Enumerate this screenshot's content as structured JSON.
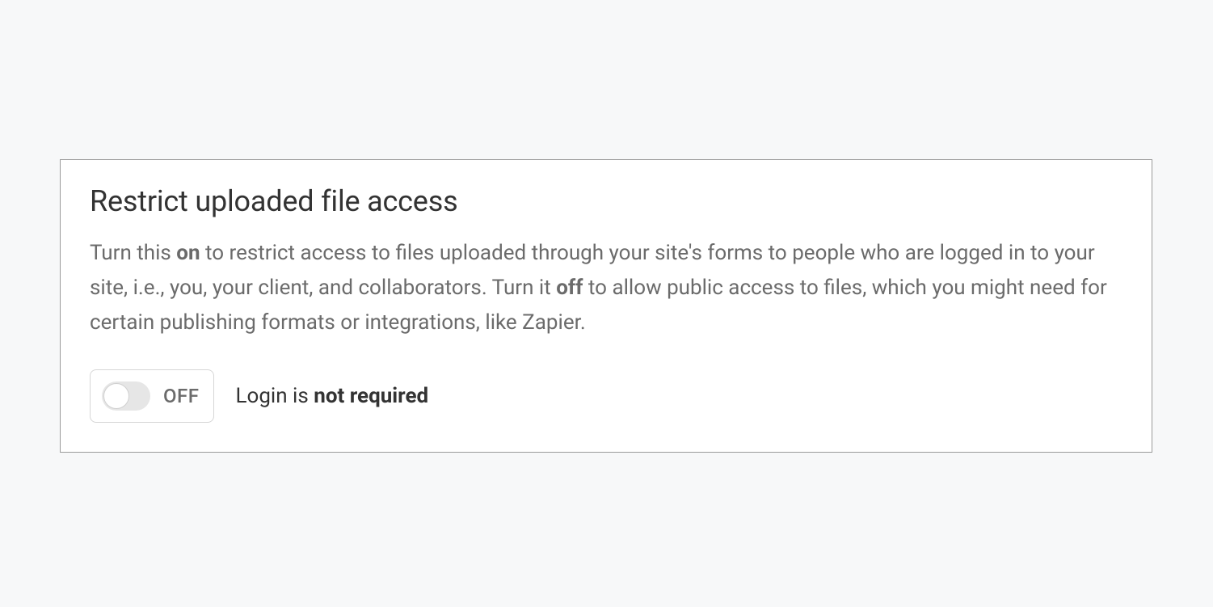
{
  "setting": {
    "title": "Restrict uploaded file access",
    "description_part1": "Turn this ",
    "description_bold1": "on",
    "description_part2": " to restrict access to files uploaded through your site's forms to people who are logged in to your site, i.e., you, your client, and collaborators. Turn it ",
    "description_bold2": "off",
    "description_part3": " to allow public access to files, which you might need for certain publishing formats or integrations, like Zapier.",
    "toggle_state_label": "OFF",
    "status_prefix": "Login is ",
    "status_bold": "not required"
  }
}
